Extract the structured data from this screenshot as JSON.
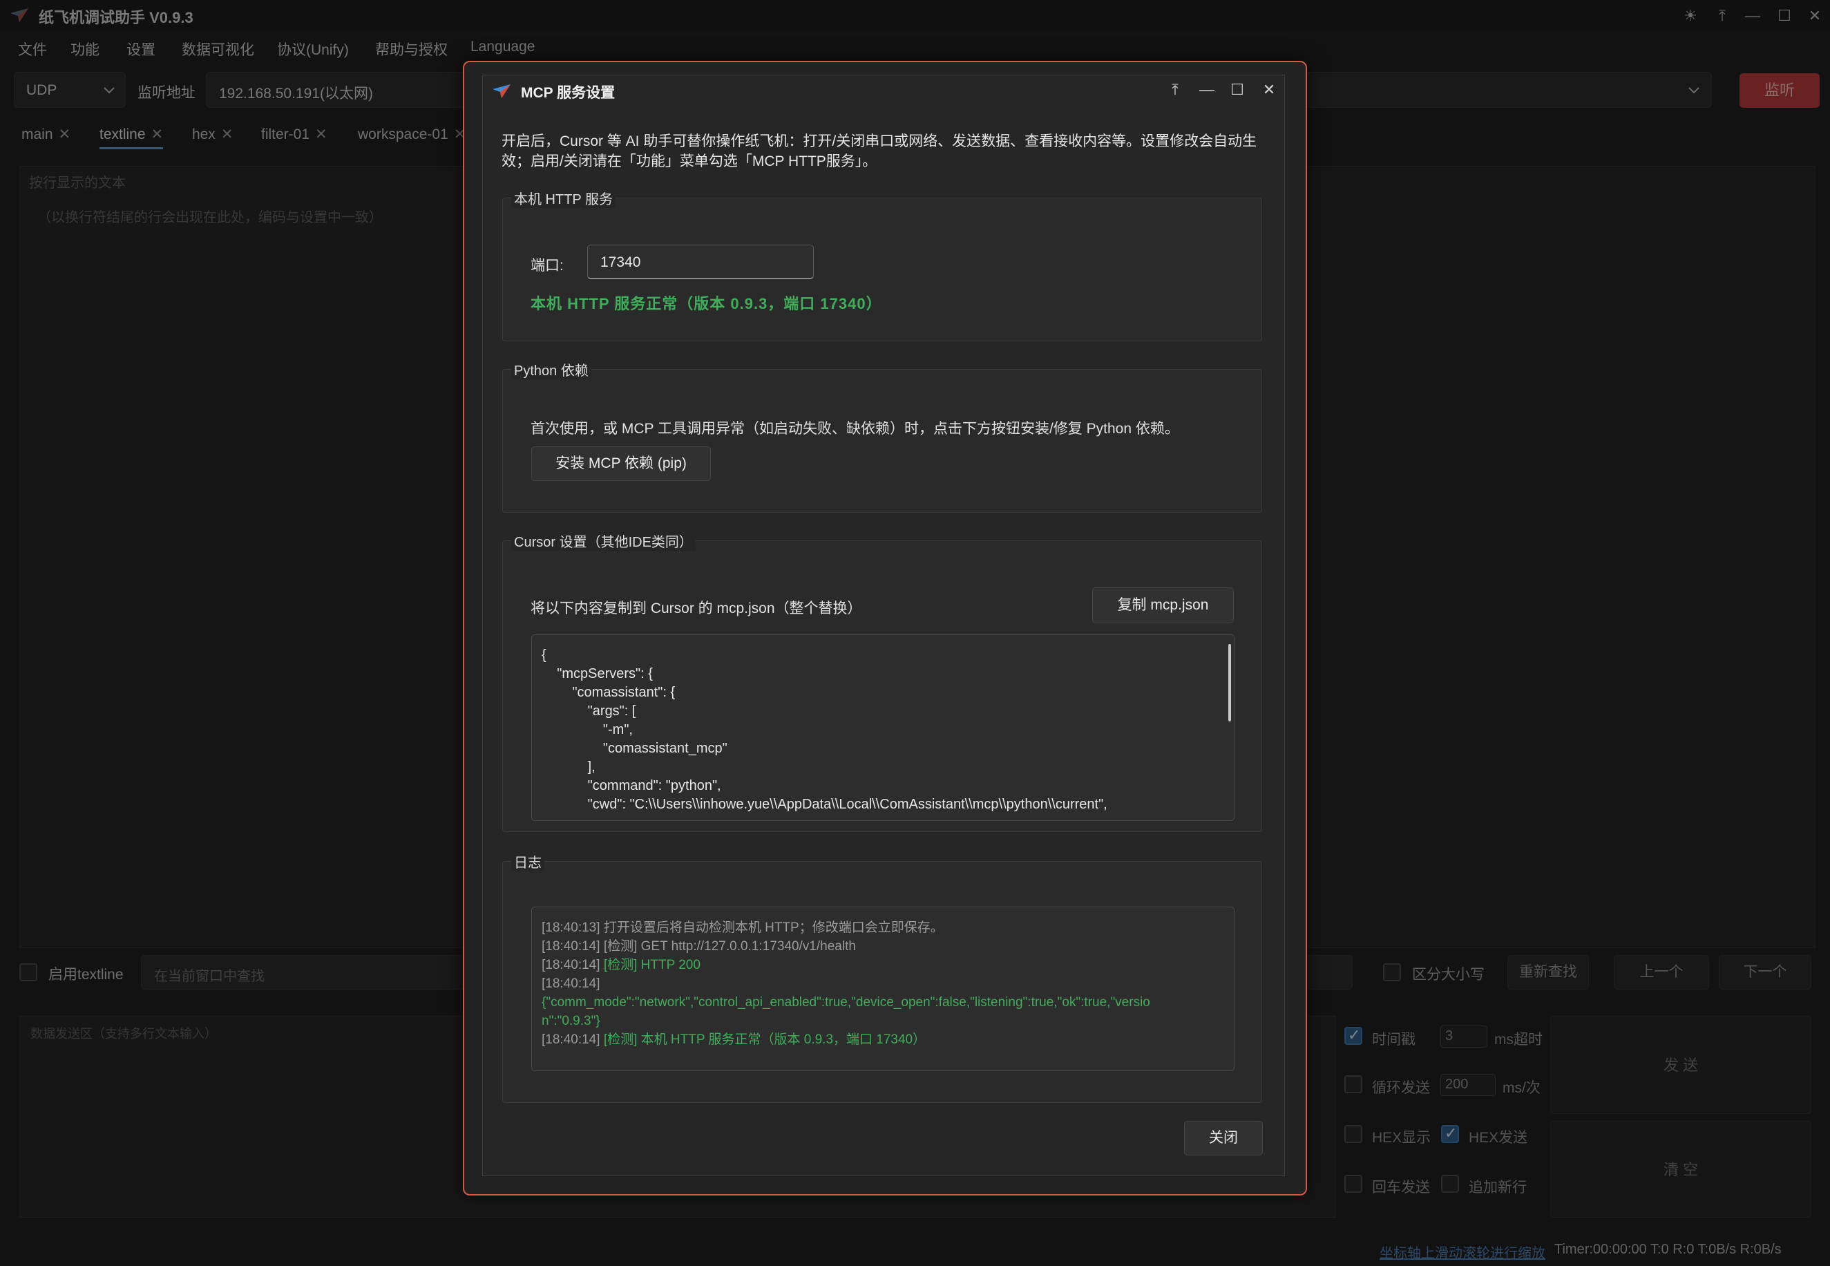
{
  "app": {
    "title": "纸飞机调试助手 V0.9.3",
    "window_controls": [
      "☀",
      "⤒",
      "—",
      "☐",
      "✕"
    ]
  },
  "menu": [
    "文件",
    "功能",
    "设置",
    "数据可视化",
    "协议(Unify)",
    "帮助与授权",
    "Language"
  ],
  "toolbar": {
    "protocol": "UDP",
    "listen_label": "监听地址",
    "address": "192.168.50.191(以太网)",
    "listen_button": "监听"
  },
  "tabs": [
    {
      "label": "main",
      "active": false
    },
    {
      "label": "textline",
      "active": true
    },
    {
      "label": "hex",
      "active": false
    },
    {
      "label": "filter-01",
      "active": false
    },
    {
      "label": "workspace-01",
      "active": false
    }
  ],
  "main_area": {
    "placeholder_title": "按行显示的文本",
    "placeholder_hint": "（以换行符结尾的行会出现在此处，编码与设置中一致）"
  },
  "search_row": {
    "enable_label": "启用textline",
    "search_placeholder": "在当前窗口中查找",
    "case_label": "区分大小写",
    "research": "重新查找",
    "prev": "上一个",
    "next": "下一个"
  },
  "send_panel": {
    "placeholder": "数据发送区（支持多行文本输入）",
    "timestamp_label": "时间戳",
    "timeout_value": "3",
    "timeout_unit": "ms超时",
    "loop_label": "循环发送",
    "loop_value": "200",
    "loop_unit": "ms/次",
    "hex_show": "HEX显示",
    "hex_send": "HEX发送",
    "enter_send": "回车发送",
    "append_newline": "追加新行",
    "send_button": "发 送",
    "clear_button": "清 空",
    "timestamp_checked": true,
    "loop_checked": false,
    "hex_show_checked": false,
    "hex_send_checked": true,
    "enter_send_checked": false,
    "append_newline_checked": false
  },
  "status": {
    "hint": "坐标轴上滑动滚轮进行缩放",
    "stats": "Timer:00:00:00  T:0 R:0    T:0B/s R:0B/s"
  },
  "dialog": {
    "title": "MCP 服务设置",
    "controls": [
      "⤒",
      "—",
      "☐",
      "✕"
    ],
    "intro": "开启后，Cursor 等 AI 助手可替你操作纸飞机：打开/关闭串口或网络、发送数据、查看接收内容等。设置修改会自动生效；启用/关闭请在「功能」菜单勾选「MCP HTTP服务」。",
    "http_group": {
      "legend": "本机 HTTP 服务",
      "port_label": "端口:",
      "port_value": "17340",
      "status": "本机 HTTP 服务正常（版本 0.9.3，端口 17340）"
    },
    "python_group": {
      "legend": "Python 依赖",
      "desc": "首次使用，或 MCP 工具调用异常（如启动失败、缺依赖）时，点击下方按钮安装/修复 Python 依赖。",
      "install_button": "安装 MCP 依赖 (pip)"
    },
    "cursor_group": {
      "legend": "Cursor 设置（其他IDE类同）",
      "desc": "将以下内容复制到 Cursor 的 mcp.json（整个替换）",
      "copy_button": "复制 mcp.json",
      "json": "{\n    \"mcpServers\": {\n        \"comassistant\": {\n            \"args\": [\n                \"-m\",\n                \"comassistant_mcp\"\n            ],\n            \"command\": \"python\",\n            \"cwd\": \"C:\\\\Users\\\\inhowe.yue\\\\AppData\\\\Local\\\\ComAssistant\\\\mcp\\\\python\\\\current\","
    },
    "log_group": {
      "legend": "日志",
      "lines": [
        {
          "time": "[18:40:13]",
          "text": "打开设置后将自动检测本机 HTTP；修改端口会立即保存。",
          "green": false
        },
        {
          "time": "[18:40:14]",
          "text": "[检测] GET http://127.0.0.1:17340/v1/health",
          "green": false
        },
        {
          "time": "[18:40:14]",
          "text": "[检测] HTTP 200",
          "green": true
        },
        {
          "time": "[18:40:14]",
          "text": "",
          "green": false
        },
        {
          "time": "",
          "text": "{\"comm_mode\":\"network\",\"control_api_enabled\":true,\"device_open\":false,\"listening\":true,\"ok\":true,\"versio",
          "green": true
        },
        {
          "time": "",
          "text": "n\":\"0.9.3\"}",
          "green": true
        },
        {
          "time": "[18:40:14]",
          "text": "[检测] 本机 HTTP 服务正常（版本 0.9.3，端口 17340）",
          "green": true
        }
      ]
    },
    "close_button": "关闭"
  },
  "colors": {
    "accent_green": "#3fae5a",
    "listen_red": "#b53a3a",
    "dialog_border": "#d65748",
    "tab_underline": "#5a9bd8"
  }
}
